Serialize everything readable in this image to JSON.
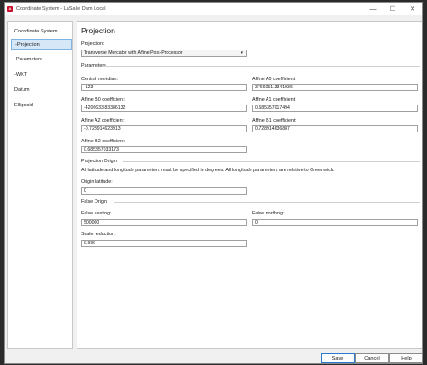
{
  "window": {
    "title": "Coordinate System - LaSalle Dam Local",
    "controls": {
      "minimize": "—",
      "maximize": "☐",
      "close": "✕"
    }
  },
  "sidebar": {
    "items": [
      {
        "label": "Coordinate System",
        "selected": false
      },
      {
        "label": "-Projection",
        "selected": true
      },
      {
        "label": "-Parameters",
        "selected": false
      },
      {
        "label": "-WKT",
        "selected": false
      },
      {
        "label": "Datum",
        "selected": false
      },
      {
        "label": "Ellipsoid",
        "selected": false
      }
    ]
  },
  "page": {
    "heading": "Projection",
    "projection_label": "Projection:",
    "projection_value": "Transverse Mercator with Affine Post-Processor",
    "parameters_section": "Parameters",
    "fields": {
      "central_meridian": {
        "label": "Central meridian:",
        "value": "-123"
      },
      "affine_a0": {
        "label": "Affine A0 coefficient:",
        "value": "3766051.3341936"
      },
      "affine_b0": {
        "label": "Affine B0 coefficient:",
        "value": "-4206633.83386132"
      },
      "affine_a1": {
        "label": "Affine A1 coefficient:",
        "value": "0.685357017494"
      },
      "affine_a2": {
        "label": "Affine A2 coefficient:",
        "value": "-0.728914623913"
      },
      "affine_b1": {
        "label": "Affine B1 coefficient:",
        "value": "0.728914636887"
      },
      "affine_b2": {
        "label": "Affine B2 coefficient:",
        "value": "0.685357033173"
      }
    },
    "origin_section": "Projection Origin",
    "origin_note": "All latitude and longitude parameters must be specified in degrees. All longitude parameters are relative to Greenwich.",
    "origin_latitude": {
      "label": "Origin latitude:",
      "value": "0"
    },
    "false_origin_section": "False Origin",
    "false_easting": {
      "label": "False easting:",
      "value": "500000"
    },
    "false_northing": {
      "label": "False northing:",
      "value": "0"
    },
    "scale_reduction": {
      "label": "Scale reduction:",
      "value": "0.996"
    }
  },
  "buttons": {
    "save": "Save",
    "cancel": "Cancel",
    "help": "Help"
  },
  "colors": {
    "selection": "#d6e8f8",
    "accent": "#2a7ad1",
    "app_icon": "#c8102e"
  }
}
